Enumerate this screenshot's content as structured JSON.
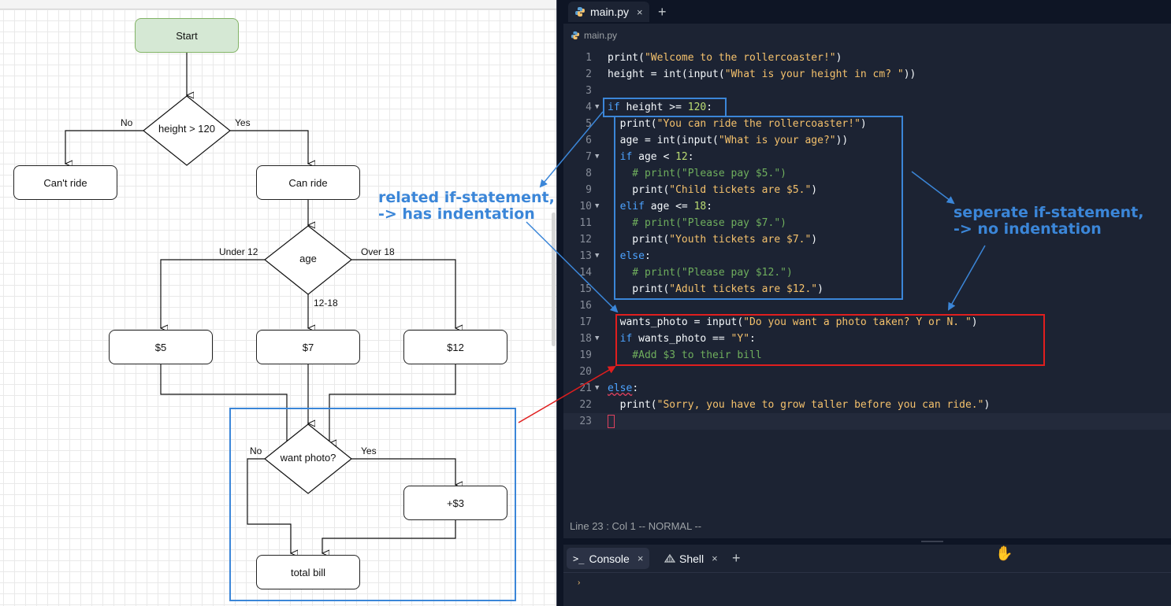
{
  "diagram": {
    "nodes": {
      "start": "Start",
      "height_check": "height > 120",
      "cant_ride": "Can't ride",
      "can_ride": "Can ride",
      "age": "age",
      "price5": "$5",
      "price7": "$7",
      "price12": "$12",
      "want_photo": "want photo?",
      "plus3": "+$3",
      "total_bill": "total bill"
    },
    "edge_labels": {
      "height_no": "No",
      "height_yes": "Yes",
      "age_under12": "Under 12",
      "age_over18": "Over 18",
      "age_12_18": "12-18",
      "photo_no": "No",
      "photo_yes": "Yes"
    }
  },
  "editor": {
    "tab": {
      "filename": "main.py",
      "close_symbol": "×",
      "add_symbol": "+"
    },
    "breadcrumb": "main.py",
    "lines": [
      {
        "n": "1",
        "fold": ""
      },
      {
        "n": "2",
        "fold": ""
      },
      {
        "n": "3",
        "fold": ""
      },
      {
        "n": "4",
        "fold": "▼"
      },
      {
        "n": "5",
        "fold": ""
      },
      {
        "n": "6",
        "fold": ""
      },
      {
        "n": "7",
        "fold": "▼"
      },
      {
        "n": "8",
        "fold": ""
      },
      {
        "n": "9",
        "fold": ""
      },
      {
        "n": "10",
        "fold": "▼"
      },
      {
        "n": "11",
        "fold": ""
      },
      {
        "n": "12",
        "fold": ""
      },
      {
        "n": "13",
        "fold": "▼"
      },
      {
        "n": "14",
        "fold": ""
      },
      {
        "n": "15",
        "fold": ""
      },
      {
        "n": "16",
        "fold": ""
      },
      {
        "n": "17",
        "fold": ""
      },
      {
        "n": "18",
        "fold": "▼"
      },
      {
        "n": "19",
        "fold": ""
      },
      {
        "n": "20",
        "fold": ""
      },
      {
        "n": "21",
        "fold": "▼"
      },
      {
        "n": "22",
        "fold": ""
      },
      {
        "n": "23",
        "fold": ""
      }
    ],
    "code": {
      "l1": [
        "print(",
        "\"Welcome to the rollercoaster!\"",
        ")"
      ],
      "l2": [
        "height = int(input(",
        "\"What is your height in cm? \"",
        "))"
      ],
      "l4": [
        "if",
        " height >= ",
        "120",
        ":"
      ],
      "l5": [
        "  print(",
        "\"You can ride the rollercoaster!\"",
        ")"
      ],
      "l6": [
        "  age = int(input(",
        "\"What is your age?\"",
        "))"
      ],
      "l7": [
        "  ",
        "if",
        " age < ",
        "12",
        ":"
      ],
      "l8": [
        "    # print(\"Please pay $5.\")"
      ],
      "l9": [
        "    print(",
        "\"Child tickets are $5.\"",
        ")"
      ],
      "l10": [
        "  ",
        "elif",
        " age <= ",
        "18",
        ":"
      ],
      "l11": [
        "    # print(\"Please pay $7.\")"
      ],
      "l12": [
        "    print(",
        "\"Youth tickets are $7.\"",
        ")"
      ],
      "l13": [
        "  ",
        "else",
        ":"
      ],
      "l14": [
        "    # print(\"Please pay $12.\")"
      ],
      "l15": [
        "    print(",
        "\"Adult tickets are $12.\"",
        ")"
      ],
      "l17": [
        "  wants_photo = input(",
        "\"Do you want a photo taken? Y or N. \"",
        ")"
      ],
      "l18": [
        "  ",
        "if",
        " wants_photo == ",
        "\"Y\"",
        ":"
      ],
      "l19": [
        "    #Add $3 to their bill"
      ],
      "l21": [
        "else",
        ":"
      ],
      "l22": [
        "  print(",
        "\"Sorry, you have to grow taller before you can ride.\"",
        ")"
      ]
    },
    "status": "Line 23 : Col 1  -- NORMAL --"
  },
  "console": {
    "tabs": {
      "console": "Console",
      "shell": "Shell",
      "close_symbol": "×",
      "add_symbol": "+"
    },
    "prompt": "›"
  },
  "annotations": {
    "related": "related if-statement,\n-> has indentation",
    "separate": "seperate if-statement,\n-> no indentation"
  },
  "colors": {
    "annotation_blue": "#3b86d8",
    "annotation_red": "#e01e1e",
    "editor_bg": "#1c2333",
    "start_fill": "#d5e8d4"
  }
}
